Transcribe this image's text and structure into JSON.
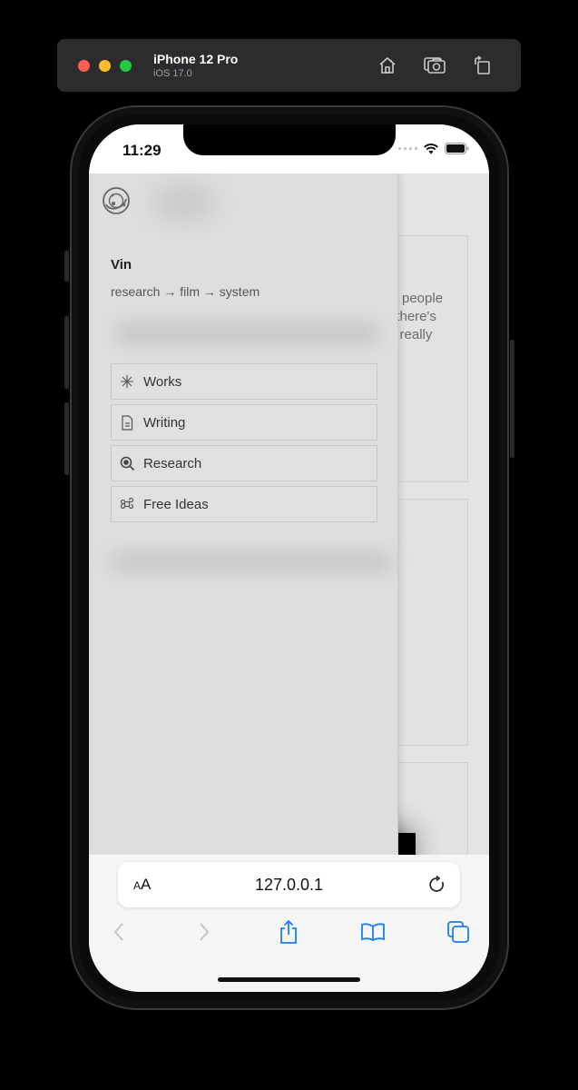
{
  "simulator": {
    "device_name": "iPhone 12 Pro",
    "os_version": "iOS 17.0",
    "traffic_lights": {
      "close": "#ff5f57",
      "minimize": "#febc2e",
      "zoom": "#28c840"
    },
    "actions": [
      {
        "icon": "home-icon",
        "label": "Home"
      },
      {
        "icon": "screenshot-icon",
        "label": "Screenshot"
      },
      {
        "icon": "rotate-icon",
        "label": "Rotate"
      }
    ]
  },
  "status_bar": {
    "time": "11:29",
    "icons": [
      "signal-dots-icon",
      "wifi-icon",
      "battery-icon"
    ]
  },
  "drawer": {
    "logo_icon": "orbit-logo-icon",
    "profile": {
      "name": "Vin",
      "tagline": "research → film → system"
    },
    "nav_items": [
      {
        "label": "Works",
        "icon": "asterisk-icon"
      },
      {
        "label": "Writing",
        "icon": "document-icon"
      },
      {
        "label": "Research",
        "icon": "magnifier-icon"
      },
      {
        "label": "Free Ideas",
        "icon": "command-icon"
      }
    ]
  },
  "background_page": {
    "visible_text_fragment": "w people\n, there's\nn really"
  },
  "safari": {
    "text_size_label_small": "A",
    "text_size_label_large": "A",
    "url": "127.0.0.1",
    "accent_color": "#1a7ef2",
    "toolbar": [
      {
        "icon": "back-icon",
        "label": "Back",
        "enabled": false
      },
      {
        "icon": "forward-icon",
        "label": "Forward",
        "enabled": false
      },
      {
        "icon": "share-icon",
        "label": "Share",
        "enabled": true
      },
      {
        "icon": "bookmarks-icon",
        "label": "Bookmarks",
        "enabled": true
      },
      {
        "icon": "tabs-icon",
        "label": "Tabs",
        "enabled": true
      }
    ]
  }
}
